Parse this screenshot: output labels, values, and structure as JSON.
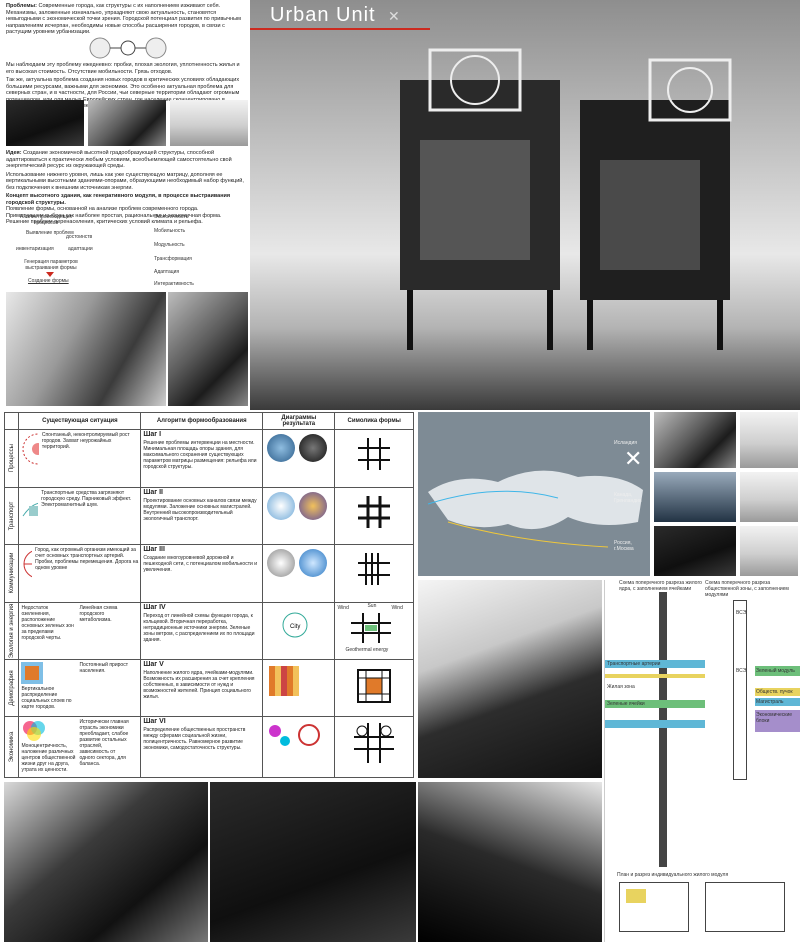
{
  "title": "Urban Unit",
  "intro": {
    "problems_label": "Проблемы:",
    "problems_text": "Современные города, как структуры с их наполнением изживают себя. Механизмы, заложенные изначально, упраздняют свою актуальность, становятся невыгодными с экономической точки зрения. Городской потенциал развития по привычным направлениям исчерпан, необходимы новые способы расширения городов, в связи с растущим уровнем урбанизации.",
    "para2": "Мы наблюдаем эту проблему ежедневно: пробки, плохая экология, уплотненность жилья и его высокая стоимость. Отсутствие мобильности. Грязь отходов.",
    "para3": "Так же, актуальна проблема создания новых городов в критических условиях обладающих большими ресурсами, важными для экономики. Это особенно актуальная проблема для северных стран, и в частности, для России, чьи северные территории обладают огромным потенциалом, или для малых Европейских стран, где население сконцентрировано в основном в южной части, а северная часть остается \"пустой\".",
    "idea_label": "Идея:",
    "idea_text": "Создание экономичной высотной градообразующей структуры, способной адаптироваться к практически любым условиям, всеобъемлющей самостоятельно свой энергетический ресурс из окружающей среды.",
    "para5": "Использование нижнего уровня, лишь как уже существующую матрицу, дополняя ее вертикальными высотными зданиями-опорами, образующими необходимый набор функций, без подключения к внешним источникам энергии.",
    "concept_text": "Концепт высотного здания, как генеративного модуля, в процессе выстраивания городской структуры.",
    "para7": "Появление формы, основанной на анализе проблем современного города.",
    "para8": "Примитуюшем выбран как наиболее простая, рациональная и экономичная форма.",
    "para9": "Решение проблем перенаселения, критических условий климата и рельефа."
  },
  "flow": {
    "left": [
      "Анализ происходящих процессов",
      "Выявление проблем",
      "достоинств",
      "инвентаризация",
      "адаптации",
      "Генерация параметров выстраивания формы",
      "Создание формы"
    ],
    "right": [
      "Экологичность",
      "Мобильность",
      "Модульность",
      "Трансформация",
      "Адаптация",
      "Интерактивность"
    ]
  },
  "table": {
    "headers": [
      "Существующая ситуация",
      "Алгоритм формообразования",
      "Диаграммы результата",
      "Симолика формы"
    ],
    "rows": [
      {
        "head": "Процессы",
        "situation": "Спонтанный, неконтролируемый рост городов. Захват неурожайных территорий.",
        "step": "Шаг I",
        "algo": "Решение проблемы интервенции на местности. Минимальная площадь опоры здания, для максимального сохранения существующих параметров матрицы размещения: рельефа или городской структуры."
      },
      {
        "head": "Транспорт",
        "situation": "Транспортные средства загрязняют городскую среду. Парниковый эффект. Электромагнитный шум.",
        "step": "Шаг II",
        "algo": "Проектирование основных каналов связи между модулями. Заложение основных магистралей. Внутренний высокопроизводительный экологичный транспорт."
      },
      {
        "head": "Коммуникации",
        "situation": "Город, как огромный организм имеющий за счет основных транспортных артерий. Пробки, проблемы перемещения. Дорога на одном уровне",
        "step": "Шаг III",
        "algo": "Создание многоуровневой дорожной и пешеходной сети, с потенциалом мобильности и увеличения."
      },
      {
        "head": "Экология и энергия",
        "situation": "Недостаток озеленения, расположение основных зеленых зон за пределами городской черты.",
        "situation2": "Линейная схема городского метаболизма.",
        "step": "Шаг IV",
        "algo": "Переход от линейной схемы функции города, к кольцевой. Вторичная переработка, нетрадиционные источники энергии. Зеленые зоны ветром, с распределением их по площади здания."
      },
      {
        "head": "Демография",
        "situation": "Вертикальное распределение социальных слоев по карте городов.",
        "situation2": "Постоянный прирост населения.",
        "step": "Шаг V",
        "algo": "Наполнение жилого ядра, ячейками-модулями. Возможность их расширения за счет крепления собственных, в зависимости от нужд и возможностей жителей. Принцип социального жилья."
      },
      {
        "head": "Экономика",
        "situation": "Моноцентричность, наложение различных центров общественной жизни друг на друга, утрата их ценности.",
        "situation2": "Исторически главная отрасль экономики преобладает, слабое развитие остальных отраслей, зависимость от одного сектора, для баланса.",
        "step": "Шаг VI",
        "algo": "Распределение общественных пространств между сферами социальной жизни, полицентричность. Равномерное развитие экономики, самодостаточность структуры."
      }
    ]
  },
  "diagram_small_labels": {
    "wind_left": "Wind",
    "sun": "Sun",
    "wind_right": "Wind",
    "geothermal": "Geothermal energy",
    "city": "City"
  },
  "map": {
    "labels": [
      "Исландия",
      "Канада, Гренландия",
      "Россия, г.Москва"
    ]
  },
  "section": {
    "left_caption": "Схема поперечного разреза жилого ядра, с заполнением ячейками",
    "right_caption": "Схема поперечного разреза общественной зоны, с заполнением модулями",
    "bands_left": [
      "Транспортные артерии",
      "Жилая зона",
      "Зеленые ячейки"
    ],
    "bands_right": [
      "Зеленый модуль",
      "Обществ. пучок",
      "Магистраль",
      "Экономические блоки"
    ],
    "marks": [
      "ВСЭ",
      "ВСЭ"
    ],
    "plan_caption": "План и разрез индивидуального жилого модуля"
  },
  "colors": {
    "accent_red": "#cc2a1f",
    "band_cyan": "#5fb7d6",
    "band_green": "#6dbf7a",
    "band_purple": "#a58ecb",
    "band_yellow": "#e8d35f",
    "map_blue": "#7e8b95"
  }
}
